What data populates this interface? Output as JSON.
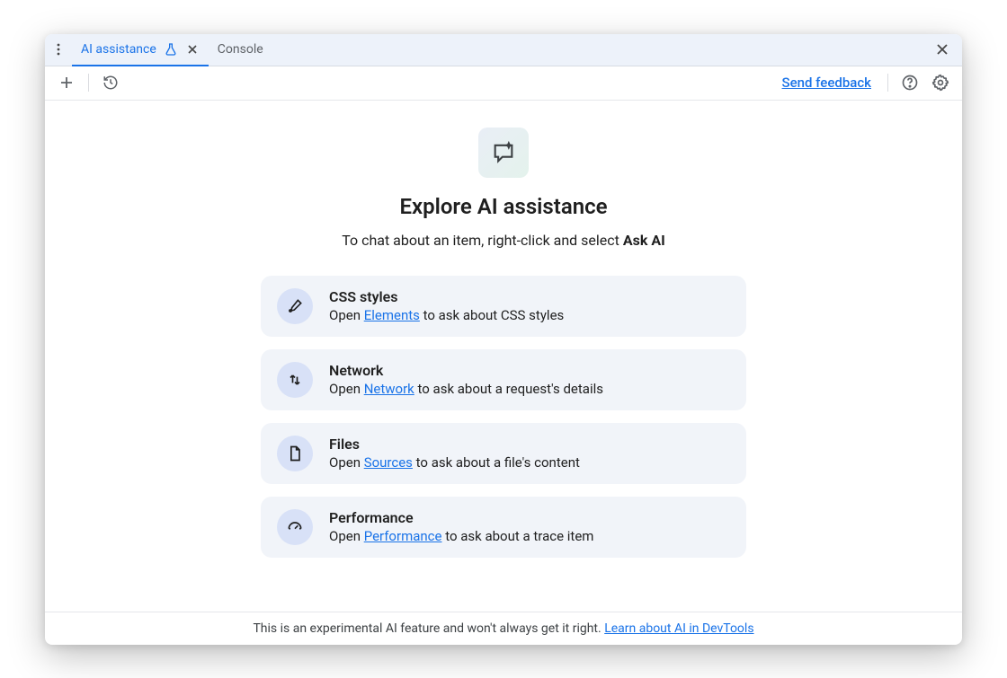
{
  "tabs": {
    "active_label": "AI assistance",
    "inactive_label": "Console"
  },
  "toolbar": {
    "send_feedback": "Send feedback"
  },
  "hero": {
    "title": "Explore AI assistance",
    "subtitle_prefix": "To chat about an item, right-click and select ",
    "subtitle_strong": "Ask AI"
  },
  "cards": [
    {
      "icon": "brush-icon",
      "title": "CSS styles",
      "desc_prefix": "Open ",
      "link_label": "Elements",
      "desc_suffix": " to ask about CSS styles"
    },
    {
      "icon": "network-icon",
      "title": "Network",
      "desc_prefix": "Open ",
      "link_label": "Network",
      "desc_suffix": " to ask about a request's details"
    },
    {
      "icon": "file-icon",
      "title": "Files",
      "desc_prefix": "Open ",
      "link_label": "Sources",
      "desc_suffix": " to ask about a file's content"
    },
    {
      "icon": "performance-icon",
      "title": "Performance",
      "desc_prefix": "Open ",
      "link_label": "Performance",
      "desc_suffix": " to ask about a trace item"
    }
  ],
  "footer": {
    "text": "This is an experimental AI feature and won't always get it right. ",
    "link_label": "Learn about AI in DevTools"
  }
}
